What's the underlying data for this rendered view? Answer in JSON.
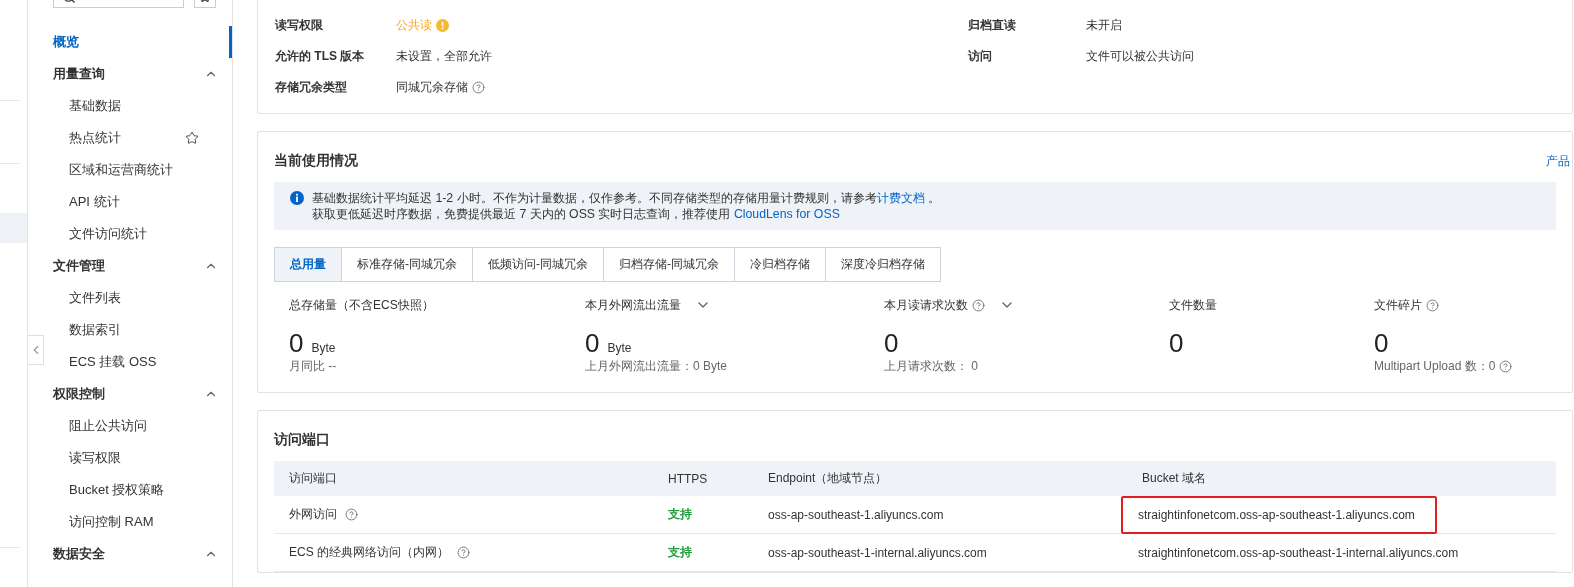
{
  "sidebar": {
    "items": [
      {
        "label": "概览",
        "selected": true
      },
      {
        "label": "用量查询",
        "selected": false,
        "expanded": true,
        "children": [
          {
            "label": "基础数据",
            "selected": false
          },
          {
            "label": "热点统计",
            "selected": false,
            "starred": false
          },
          {
            "label": "区域和运营商统计",
            "selected": false
          },
          {
            "label": "API 统计",
            "selected": false
          },
          {
            "label": "文件访问统计",
            "selected": false
          }
        ]
      },
      {
        "label": "文件管理",
        "selected": false,
        "expanded": true,
        "children": [
          {
            "label": "文件列表",
            "selected": false
          },
          {
            "label": "数据索引",
            "selected": false
          },
          {
            "label": "ECS 挂载 OSS",
            "selected": false
          }
        ]
      },
      {
        "label": "权限控制",
        "selected": false,
        "expanded": true,
        "children": [
          {
            "label": "阻止公共访问",
            "selected": false
          },
          {
            "label": "读写权限",
            "selected": false
          },
          {
            "label": "Bucket 授权策略",
            "selected": false
          },
          {
            "label": "访问控制 RAM",
            "selected": false
          }
        ]
      },
      {
        "label": "数据安全",
        "selected": false,
        "expanded": true
      }
    ]
  },
  "properties": [
    {
      "label": "读写权限",
      "value": "公共读",
      "warning": true
    },
    {
      "label": "归档直读",
      "value": "未开启"
    },
    {
      "label": "允许的 TLS 版本",
      "value": "未设置，全部允许"
    },
    {
      "label": "访问",
      "value": "文件可以被公共访问"
    },
    {
      "label": "存储冗余类型",
      "value": "同城冗余存储",
      "help": true
    }
  ],
  "usage": {
    "title": "当前使用情况",
    "link": "产品",
    "notice": [
      {
        "text": "基础数据统计平均延迟 1-2 小时。不作为计量数据，仅作参考。不同存储类型的存储用量计费规则，请参考",
        "link": "计费文档",
        "after": " 。"
      },
      {
        "text": "获取更低延迟时序数据，免费提供最近 7 天内的 OSS 实时日志查询，推荐使用 ",
        "link": "CloudLens for OSS"
      }
    ],
    "tabs": [
      {
        "label": "总用量",
        "selected": true
      },
      {
        "label": "标准存储-同城冗余",
        "selected": false
      },
      {
        "label": "低频访问-同城冗余",
        "selected": false
      },
      {
        "label": "归档存储-同城冗余",
        "selected": false
      },
      {
        "label": "冷归档存储",
        "selected": false
      },
      {
        "label": "深度冷归档存储",
        "selected": false
      }
    ],
    "metrics": [
      {
        "label": "总存储量（不含ECS快照）",
        "value": "0",
        "unit": "Byte",
        "sub": "月同比 --"
      },
      {
        "label": "本月外网流出流量",
        "dropdown": true,
        "value": "0",
        "unit": "Byte",
        "sub": "上月外网流出流量：0 Byte"
      },
      {
        "label": "本月读请求次数",
        "help": true,
        "dropdown": true,
        "value": "0",
        "sub": "上月请求次数： 0"
      },
      {
        "label": "文件数量",
        "value": "0"
      },
      {
        "label": "文件碎片",
        "help": true,
        "value": "0",
        "sub": "Multipart Upload 数：0",
        "sub_help": true
      }
    ]
  },
  "endpoints": {
    "title": "访问端口",
    "columns": [
      "访问端口",
      "HTTPS",
      "Endpoint（地域节点）",
      "Bucket 域名"
    ],
    "rows": [
      {
        "port": "外网访问",
        "help": true,
        "https": "支持",
        "endpoint": "oss-ap-southeast-1.aliyuncs.com",
        "domain": "straightinfonetcom.oss-ap-southeast-1.aliyuncs.com",
        "highlighted": true
      },
      {
        "port": "ECS 的经典网络访问（内网）",
        "help": true,
        "https": "支持",
        "endpoint": "oss-ap-southeast-1-internal.aliyuncs.com",
        "domain": "straightinfonetcom.oss-ap-southeast-1-internal.aliyuncs.com",
        "highlighted": false
      }
    ]
  }
}
